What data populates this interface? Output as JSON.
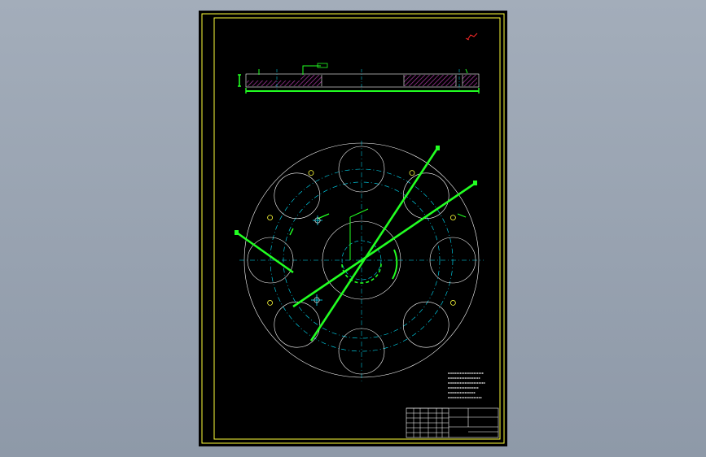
{
  "drawing": {
    "colors": {
      "background": "#000000",
      "frame": "#ffff3a",
      "outline": "#ffffff",
      "centerline": "#00e5ff",
      "leader": "#22ff22",
      "hatch": "#b03aa8",
      "mark": "#ff2a2a"
    },
    "views": [
      "section-view",
      "plan-view"
    ],
    "plan_view": {
      "large_holes": 8,
      "small_holes": 6
    },
    "title_block": {
      "name_cell": "",
      "material_cell": ""
    },
    "notes": {
      "heading": "",
      "lines": [
        "",
        "",
        "",
        "",
        "",
        ""
      ]
    }
  }
}
